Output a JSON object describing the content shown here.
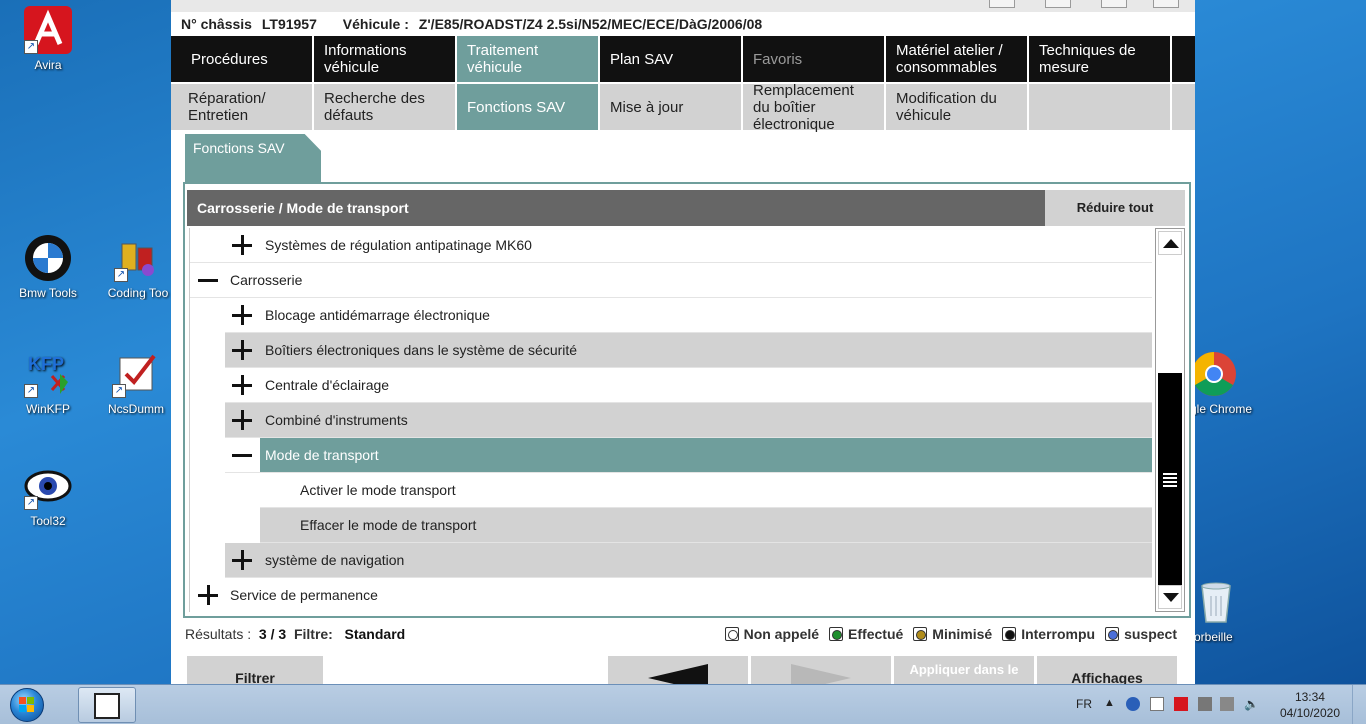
{
  "desktop": {
    "icons": [
      {
        "label": "Avira",
        "icon": "avira-icon"
      },
      {
        "label": "Bmw Tools",
        "icon": "bmw-logo-icon"
      },
      {
        "label": "Coding Too",
        "icon": "coding-tool-icon"
      },
      {
        "label": "WinKFP",
        "icon": "winkfp-icon"
      },
      {
        "label": "NcsDumm",
        "icon": "ncsdummy-icon"
      },
      {
        "label": "Tool32",
        "icon": "eye-icon"
      },
      {
        "label": "gle Chrome",
        "icon": "chrome-icon"
      },
      {
        "label": "orbeille",
        "icon": "recycle-bin-icon"
      }
    ]
  },
  "vehicle": {
    "chassis_label": "N° châssis",
    "chassis_value": "LT91957",
    "vehicle_label": "Véhicule :",
    "vehicle_value": "Z'/E85/ROADST/Z4 2.5si/N52/MEC/ECE/DàG/2006/08"
  },
  "nav_main": [
    {
      "label": "Procédures",
      "state": "normal"
    },
    {
      "label": "Informations véhicule",
      "state": "normal"
    },
    {
      "label": "Traitement véhicule",
      "state": "active"
    },
    {
      "label": "Plan SAV",
      "state": "normal"
    },
    {
      "label": "Favoris",
      "state": "disabled"
    },
    {
      "label": "Matériel atelier / consommables",
      "state": "normal"
    },
    {
      "label": "Techniques de mesure",
      "state": "normal"
    }
  ],
  "nav_sub": [
    {
      "label": "Réparation/ Entretien",
      "state": "normal"
    },
    {
      "label": "Recherche des défauts",
      "state": "normal"
    },
    {
      "label": "Fonctions SAV",
      "state": "active"
    },
    {
      "label": "Mise à jour",
      "state": "normal"
    },
    {
      "label": "Remplacement du boîtier électronique",
      "state": "normal"
    },
    {
      "label": "Modification du véhicule",
      "state": "normal"
    },
    {
      "label": "",
      "state": "normal"
    }
  ],
  "subtab": {
    "label": "Fonctions SAV"
  },
  "panel": {
    "title": "Carrosserie / Mode de transport",
    "collapse_all": "Réduire tout"
  },
  "tree": [
    {
      "label": "Systèmes de régulation antipatinage MK60",
      "level": 1,
      "sign": "plus",
      "style": "white"
    },
    {
      "label": "Carrosserie",
      "level": 0,
      "sign": "minus",
      "style": "white"
    },
    {
      "label": "Blocage antidémarrage électronique",
      "level": 1,
      "sign": "plus",
      "style": "white"
    },
    {
      "label": "Boîtiers électroniques dans le système de sécurité",
      "level": 1,
      "sign": "plus",
      "style": "grey"
    },
    {
      "label": "Centrale d'éclairage",
      "level": 1,
      "sign": "plus",
      "style": "white"
    },
    {
      "label": "Combiné d'instruments",
      "level": 1,
      "sign": "plus",
      "style": "grey"
    },
    {
      "label": "Mode de transport",
      "level": 1,
      "sign": "minus",
      "style": "selected"
    },
    {
      "label": "Activer le mode transport",
      "level": 2,
      "sign": "none",
      "style": "white"
    },
    {
      "label": "Effacer le mode de transport",
      "level": 2,
      "sign": "none",
      "style": "grey"
    },
    {
      "label": "système de navigation",
      "level": 1,
      "sign": "plus",
      "style": "grey"
    },
    {
      "label": "Service de permanence",
      "level": 0,
      "sign": "plus",
      "style": "white"
    }
  ],
  "status": {
    "results_label": "Résultats :",
    "results_value": "3 / 3",
    "filter_label": "Filtre:",
    "filter_value": "Standard"
  },
  "legend": [
    {
      "label": "Non appelé",
      "color": "#ffffff",
      "cls": "white"
    },
    {
      "label": "Effectué",
      "color": "#1f8f2e",
      "cls": "green"
    },
    {
      "label": "Minimisé",
      "color": "#b08c1a",
      "cls": "gold"
    },
    {
      "label": "Interrompu",
      "color": "#111111",
      "cls": "black"
    },
    {
      "label": "suspect",
      "color": "#4a6ed8",
      "cls": "blue"
    }
  ],
  "bottom_buttons": {
    "filter": "Filtrer",
    "apply": "Appliquer dans le",
    "display": "Affichages"
  },
  "taskbar": {
    "language": "FR",
    "time": "13:34",
    "date": "04/10/2020"
  },
  "colors": {
    "accent": "#6f9e9c",
    "nav_dark": "#111111",
    "nav_light": "#d2d2d2",
    "header_grey": "#666666"
  }
}
